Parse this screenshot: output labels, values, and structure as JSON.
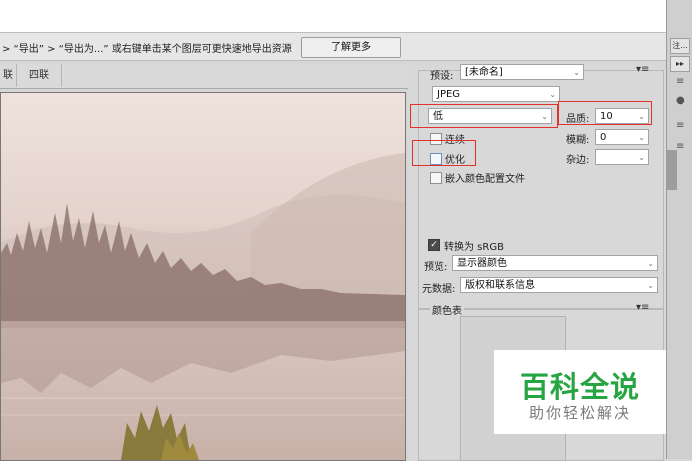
{
  "tip": {
    "text": "> “导出” > “导出为...” 或右键单击某个图层可更快速地导出资源",
    "learn_more": "了解更多"
  },
  "tabs": [
    "联",
    "四联"
  ],
  "settings": {
    "preset_label": "预设:",
    "preset_value": "[未命名]",
    "format_value": "JPEG",
    "quality_preset_value": "低",
    "quality_label": "品质:",
    "quality_value": "10",
    "progressive_label": "连续",
    "blur_label": "模糊:",
    "blur_value": "0",
    "optimized_label": "优化",
    "matte_label": "杂边:",
    "embed_profile_label": "嵌入颜色配置文件",
    "convert_srgb_label": "转换为 sRGB",
    "preview_label": "预览:",
    "preview_value": "显示器颜色",
    "metadata_label": "元数据:",
    "metadata_value": "版权和联系信息",
    "color_table_label": "颜色表"
  },
  "outer_right": {
    "btn1": "注...",
    "btn2": "▸▸"
  },
  "watermark": {
    "title": "百科全说",
    "subtitle": "助你轻松解决"
  },
  "colors": {
    "watermark_green": "#27a543",
    "highlight_red": "#e2332b"
  }
}
